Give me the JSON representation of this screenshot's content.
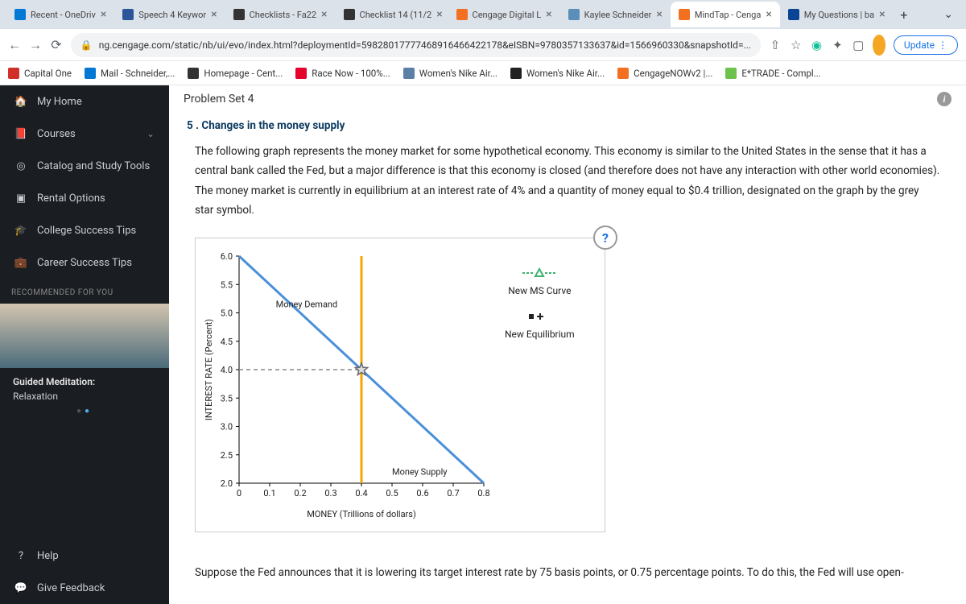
{
  "tabs": [
    {
      "label": "Recent - OneDriv",
      "favicon": "#0078d4"
    },
    {
      "label": "Speech 4 Keywor",
      "favicon": "#2b579a"
    },
    {
      "label": "Checklists - Fa22",
      "favicon": "#333"
    },
    {
      "label": "Checklist 14 (11/2",
      "favicon": "#333"
    },
    {
      "label": "Cengage Digital L",
      "favicon": "#f37021"
    },
    {
      "label": "Kaylee Schneider",
      "favicon": "#5b8fb9"
    },
    {
      "label": "MindTap - Cenga",
      "favicon": "#f37021",
      "active": true
    },
    {
      "label": "My Questions | ba",
      "favicon": "#0a4595"
    }
  ],
  "url": "ng.cengage.com/static/nb/ui/evo/index.html?deploymentId=59828017777468916466422178&eISBN=9780357133637&id=1566960330&snapshotId=...",
  "update_label": "Update",
  "bookmarks": [
    {
      "label": "Capital One",
      "color": "#d03027"
    },
    {
      "label": "Mail - Schneider,...",
      "color": "#0078d4"
    },
    {
      "label": "Homepage - Cent...",
      "color": "#333"
    },
    {
      "label": "Race Now - 100%...",
      "color": "#e4002b"
    },
    {
      "label": "Women's Nike Air...",
      "color": "#5b7fa6"
    },
    {
      "label": "Women's Nike Air...",
      "color": "#222"
    },
    {
      "label": "CengageNOWv2 |...",
      "color": "#f37021"
    },
    {
      "label": "E*TRADE - Compl...",
      "color": "#6cc24a"
    }
  ],
  "sidebar": {
    "items": [
      {
        "label": "My Home",
        "icon": "home"
      },
      {
        "label": "Courses",
        "icon": "book",
        "expandable": true
      },
      {
        "label": "Catalog and Study Tools",
        "icon": "compass"
      },
      {
        "label": "Rental Options",
        "icon": "box"
      },
      {
        "label": "College Success Tips",
        "icon": "grad"
      },
      {
        "label": "Career Success Tips",
        "icon": "briefcase"
      }
    ],
    "recommended_label": "RECOMMENDED FOR YOU",
    "reco_title": "Guided Meditation:",
    "reco_sub": "Relaxation",
    "help_label": "Help",
    "feedback_label": "Give Feedback"
  },
  "content": {
    "header": "Problem Set 4",
    "question_title": "5 . Changes in the money supply",
    "body": "The following graph represents the money market for some hypothetical economy. This economy is similar to the United States in the sense that it has a central bank called the Fed, but a major difference is that this economy is closed (and therefore does not have any interaction with other world economies). The money market is currently in equilibrium at an interest rate of 4% and a quantity of money equal to $0.4 trillion, designated on the graph by the grey star symbol.",
    "bottom": "Suppose the Fed announces that it is lowering its target interest rate by 75 basis points, or 0.75 percentage points. To do this, the Fed will use open-"
  },
  "legend": {
    "ms_label": "New MS Curve",
    "eq_label": "New Equilibrium"
  },
  "chart_data": {
    "type": "line",
    "xlabel": "MONEY (Trillions of dollars)",
    "ylabel": "INTEREST RATE (Percent)",
    "xlim": [
      0,
      0.8
    ],
    "ylim": [
      2.0,
      6.0
    ],
    "xticks": [
      0,
      0.1,
      0.2,
      0.3,
      0.4,
      0.5,
      0.6,
      0.7,
      0.8
    ],
    "yticks": [
      2.0,
      2.5,
      3.0,
      3.5,
      4.0,
      4.5,
      5.0,
      5.5,
      6.0
    ],
    "series": [
      {
        "name": "Money Demand",
        "color": "#4a90d9",
        "points": [
          [
            0,
            6.0
          ],
          [
            0.8,
            2.0
          ]
        ]
      },
      {
        "name": "Money Supply",
        "color": "#f7a400",
        "vertical_x": 0.4
      }
    ],
    "equilibrium": {
      "x": 0.4,
      "y": 4.0,
      "marker": "star",
      "color": "#888"
    },
    "annotations": [
      {
        "text": "Money Demand",
        "x": 0.12,
        "y": 5.1
      },
      {
        "text": "Money Supply",
        "x": 0.5,
        "y": 2.15
      }
    ]
  }
}
